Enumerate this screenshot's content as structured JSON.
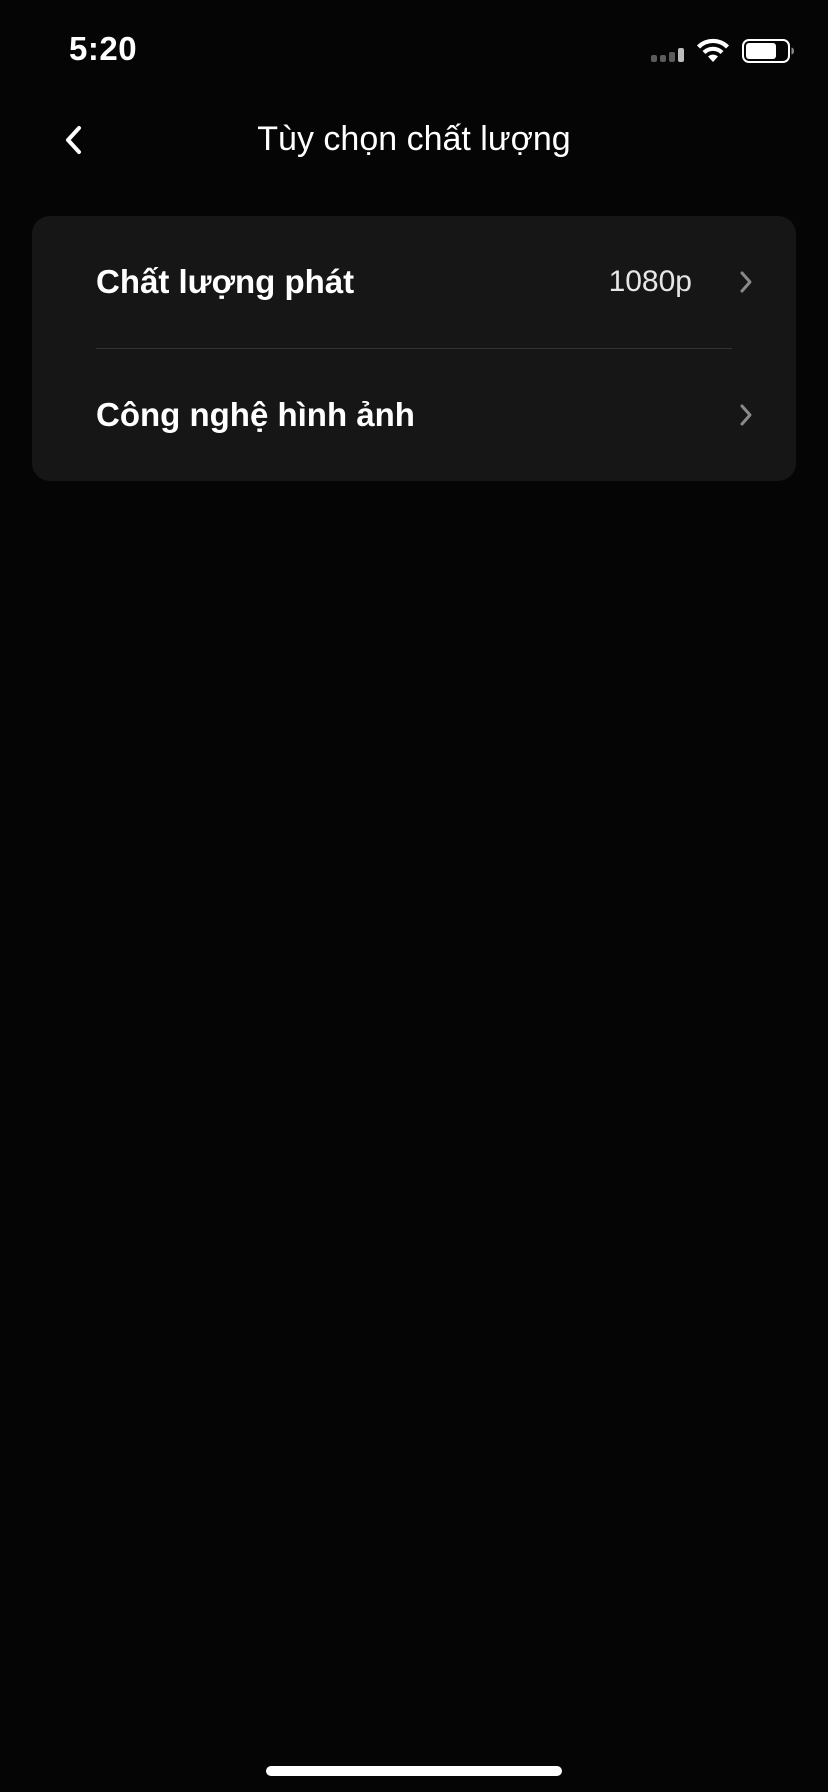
{
  "status_bar": {
    "time": "5:20",
    "signal_icon": "cellular-signal-icon",
    "wifi_icon": "wifi-icon",
    "battery_icon": "battery-icon",
    "battery_level": 0.75
  },
  "nav": {
    "back_icon": "chevron-left-icon",
    "title": "Tùy chọn chất lượng"
  },
  "settings": {
    "items": [
      {
        "label": "Chất lượng phát",
        "value": "1080p",
        "icon": "chevron-right-icon"
      },
      {
        "label": "Công nghệ hình ảnh",
        "value": "",
        "icon": "chevron-right-icon"
      }
    ]
  },
  "colors": {
    "background": "#050505",
    "card": "#161616",
    "divider": "#333333",
    "text_primary": "#ffffff",
    "text_secondary": "#e6e6e6",
    "chevron": "#8a8a8a"
  }
}
